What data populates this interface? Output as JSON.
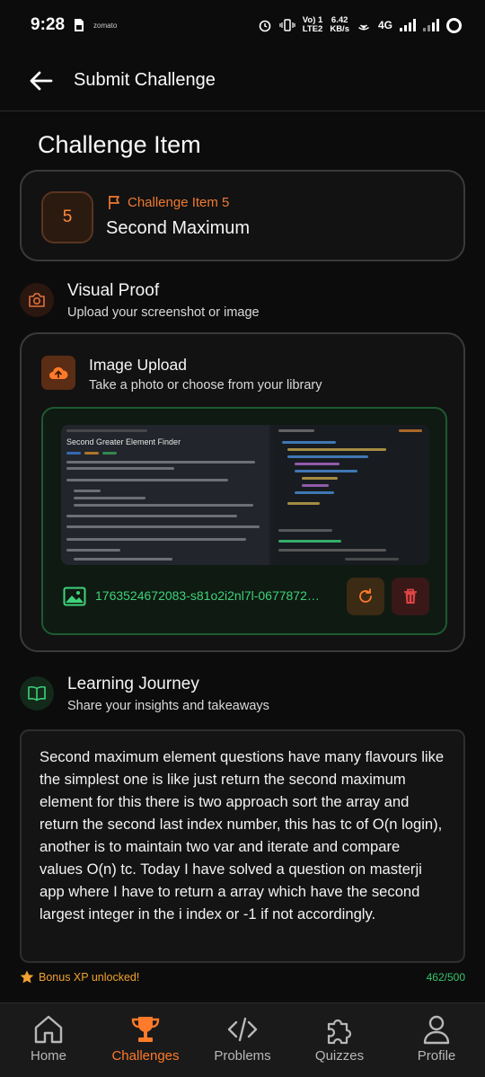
{
  "status_bar": {
    "time": "9:28",
    "carrier_small": "zomato",
    "volte_line1": "Vo) 1",
    "volte_line2": "LTE2",
    "speed_line1": "6.42",
    "speed_line2": "KB/s",
    "network": "4G"
  },
  "app_bar": {
    "title": "Submit Challenge"
  },
  "challenge": {
    "section_title": "Challenge Item",
    "number": "5",
    "label": "Challenge Item 5",
    "name": "Second Maximum"
  },
  "visual_proof": {
    "title": "Visual Proof",
    "subtitle": "Upload your screenshot or image"
  },
  "image_upload": {
    "title": "Image Upload",
    "subtitle": "Take a photo or choose from your library",
    "preview_heading": "Second Greater Element Finder",
    "file_name": "1763524672083-s81o2i2nl7l-0677872…"
  },
  "learning_journey": {
    "title": "Learning Journey",
    "subtitle": "Share your insights and takeaways",
    "text": "Second maximum element questions have many flavours like the simplest one is like just return the second maximum element for this there is two approach sort the array and return the second last index number, this has tc of O(n login), another is to maintain two var and iterate and compare values O(n) tc. Today I have solved a question on masterji app where I have to return a array which have the second largest integer in the i index or -1 if not accordingly."
  },
  "footer": {
    "bonus": "Bonus XP unlocked!",
    "counter": "462/500"
  },
  "nav": {
    "items": [
      {
        "label": "Home",
        "icon": "home-icon",
        "active": false
      },
      {
        "label": "Challenges",
        "icon": "trophy-icon",
        "active": true
      },
      {
        "label": "Problems",
        "icon": "code-icon",
        "active": false
      },
      {
        "label": "Quizzes",
        "icon": "puzzle-icon",
        "active": false
      },
      {
        "label": "Profile",
        "icon": "person-icon",
        "active": false
      }
    ]
  },
  "colors": {
    "accent": "#ff7a2a",
    "success": "#3ed27a",
    "danger": "#e04444",
    "background": "#0c0c0c"
  }
}
